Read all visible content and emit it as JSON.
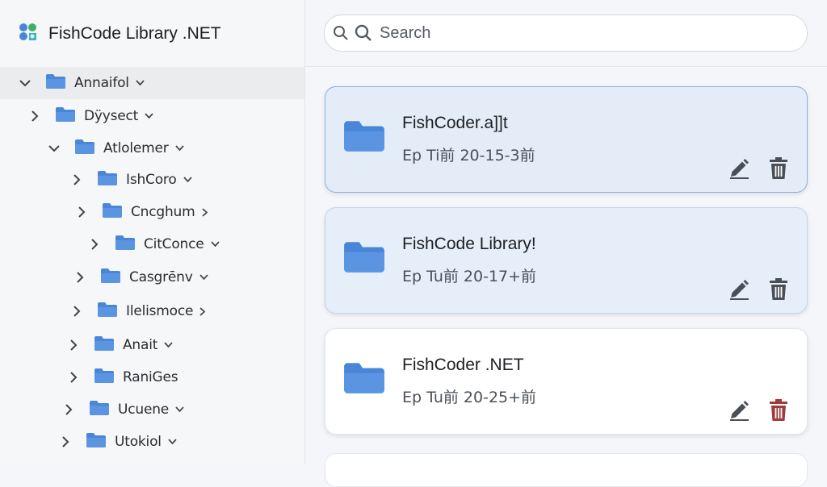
{
  "app": {
    "title": "FishCode Library .NET"
  },
  "search": {
    "placeholder": "Search"
  },
  "tree": [
    {
      "label": "Annaifol",
      "expanded": true,
      "selected": true,
      "caret": "down"
    },
    {
      "label": "Dÿysect",
      "expanded": false,
      "caret": "down"
    },
    {
      "label": "Atlolemer",
      "expanded": true,
      "caret": "down"
    },
    {
      "label": "IshCoro",
      "expanded": false,
      "caret": "down"
    },
    {
      "label": "Cncghum",
      "expanded": false,
      "caret": "right"
    },
    {
      "label": "CitConce",
      "expanded": false,
      "caret": "down"
    },
    {
      "label": "Casgrēnv",
      "expanded": false,
      "caret": "down"
    },
    {
      "label": "Ilelismoce",
      "expanded": false,
      "caret": "right"
    },
    {
      "label": "Anait",
      "expanded": false,
      "caret": "down"
    },
    {
      "label": "RaniGes",
      "expanded": false,
      "caret": "none"
    },
    {
      "label": "Ucuene",
      "expanded": false,
      "caret": "down"
    },
    {
      "label": "Utokiol",
      "expanded": false,
      "caret": "down"
    }
  ],
  "cards": [
    {
      "name": "FishCoder.a]]t",
      "meta": "Ep Ti前 20-15-3前",
      "state": "active",
      "delete_color": "#4a4f57"
    },
    {
      "name": "FishCode Library!",
      "meta": "Ep Tu前 20-17+前",
      "state": "hover",
      "delete_color": "#4a4f57"
    },
    {
      "name": "FishCoder .NET",
      "meta": "Ep Tu前 20-25+前",
      "state": "normal",
      "delete_color": "#a33a3a"
    }
  ],
  "colors": {
    "accent": "#4a86d8",
    "folder": "#4a86d8",
    "selected_border": "#8eaee0"
  }
}
